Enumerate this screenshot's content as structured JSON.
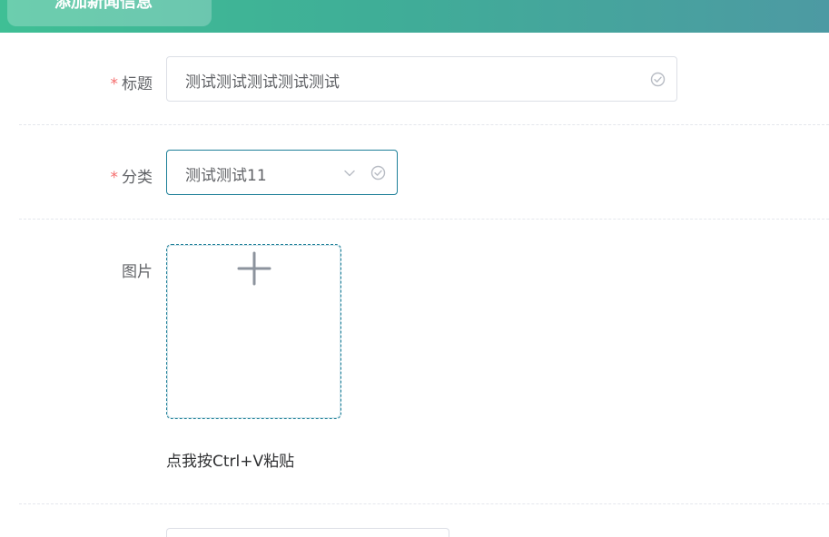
{
  "header": {
    "tab_label": "添加新闻信息"
  },
  "form": {
    "title": {
      "label": "标题",
      "required_mark": "*",
      "value": "测试测试测试测试测试"
    },
    "category": {
      "label": "分类",
      "required_mark": "*",
      "selected": "测试测试11"
    },
    "image": {
      "label": "图片",
      "paste_hint": "点我按Ctrl+V粘贴"
    }
  },
  "colors": {
    "header_start": "#3fbf95",
    "header_end": "#4d9aa3",
    "required": "#f56c6c",
    "focus_border": "#1d7f98"
  }
}
